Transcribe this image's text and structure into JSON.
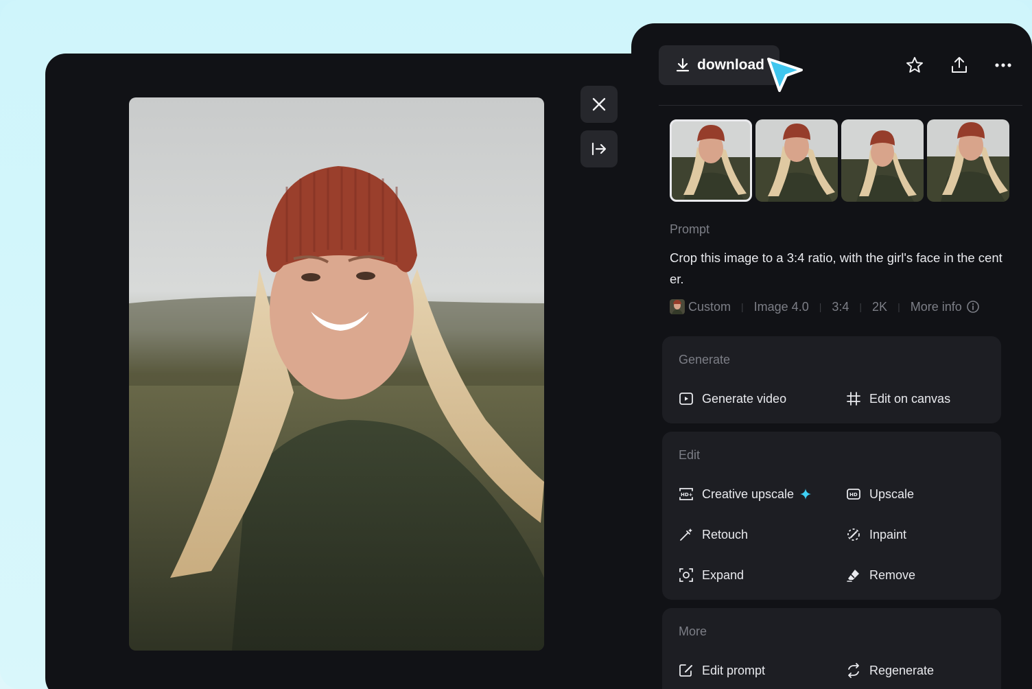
{
  "viewer": {
    "close_icon": "close-icon",
    "collapse_icon": "collapse-right-icon"
  },
  "header": {
    "download_label": "download",
    "icons": [
      "star-icon",
      "share-icon",
      "more-icon"
    ]
  },
  "thumbnails": {
    "count": 4,
    "selected": 0
  },
  "prompt": {
    "label": "Prompt",
    "text": "Crop this image to a 3:4 ratio, with the girl's face in the center."
  },
  "meta": {
    "style": "Custom",
    "model": "Image 4.0",
    "ratio": "3:4",
    "resolution": "2K",
    "more_info": "More info"
  },
  "sections": {
    "generate": {
      "title": "Generate",
      "generate_video": "Generate video",
      "edit_on_canvas": "Edit on canvas"
    },
    "edit": {
      "title": "Edit",
      "creative_upscale": "Creative upscale",
      "upscale": "Upscale",
      "retouch": "Retouch",
      "inpaint": "Inpaint",
      "expand": "Expand",
      "remove": "Remove"
    },
    "more": {
      "title": "More",
      "edit_prompt": "Edit prompt",
      "regenerate": "Regenerate"
    }
  },
  "colors": {
    "panel_bg": "#111216",
    "card_bg": "#1d1e23",
    "accent_cursor": "#3fc6ee",
    "sparkle": "#3fd0f5"
  }
}
